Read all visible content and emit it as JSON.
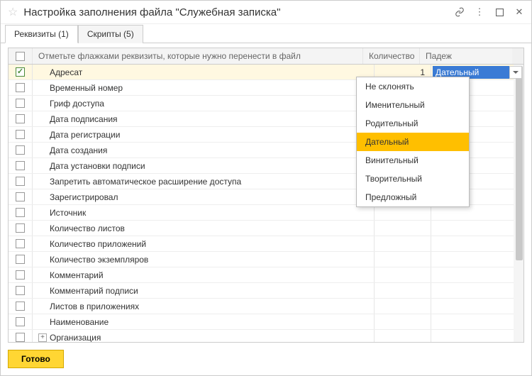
{
  "window": {
    "title": "Настройка заполнения файла \"Служебная записка\""
  },
  "tabs": [
    {
      "label": "Реквизиты (1)",
      "active": true
    },
    {
      "label": "Скрипты (5)",
      "active": false
    }
  ],
  "grid": {
    "headers": {
      "name": "Отметьте флажками реквизиты, которые нужно перенести в файл",
      "qty": "Количество",
      "case": "Падеж"
    },
    "rows": [
      {
        "checked": true,
        "name": "Адресат",
        "qty": "1",
        "case": "Дательный",
        "selected": true,
        "expandable": false
      },
      {
        "checked": false,
        "name": "Временный номер"
      },
      {
        "checked": false,
        "name": "Гриф доступа"
      },
      {
        "checked": false,
        "name": "Дата подписания"
      },
      {
        "checked": false,
        "name": "Дата регистрации"
      },
      {
        "checked": false,
        "name": "Дата создания"
      },
      {
        "checked": false,
        "name": "Дата установки подписи"
      },
      {
        "checked": false,
        "name": "Запретить автоматическое расширение доступа"
      },
      {
        "checked": false,
        "name": "Зарегистрировал"
      },
      {
        "checked": false,
        "name": "Источник"
      },
      {
        "checked": false,
        "name": "Количество листов"
      },
      {
        "checked": false,
        "name": "Количество приложений"
      },
      {
        "checked": false,
        "name": "Количество экземпляров"
      },
      {
        "checked": false,
        "name": "Комментарий"
      },
      {
        "checked": false,
        "name": "Комментарий подписи"
      },
      {
        "checked": false,
        "name": "Листов в приложениях"
      },
      {
        "checked": false,
        "name": "Наименование"
      },
      {
        "checked": false,
        "name": "Организация",
        "expandable": true
      }
    ]
  },
  "dropdown": {
    "items": [
      "Не склонять",
      "Именительный",
      "Родительный",
      "Дательный",
      "Винительный",
      "Творительный",
      "Предложный"
    ],
    "highlight": "Дательный"
  },
  "footer": {
    "ready": "Готово"
  }
}
